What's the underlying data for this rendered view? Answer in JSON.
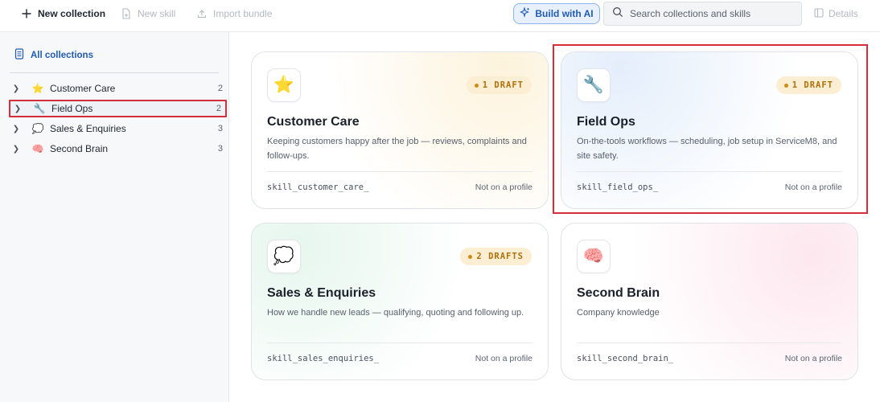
{
  "toolbar": {
    "new_collection": "New collection",
    "new_skill": "New skill",
    "import_bundle": "Import bundle",
    "build_ai": "Build with AI",
    "search_placeholder": "Search collections and skills",
    "details": "Details"
  },
  "sidebar": {
    "all_collections": "All collections",
    "items": [
      {
        "emoji": "⭐",
        "label": "Customer Care",
        "count": "2"
      },
      {
        "emoji": "🔧",
        "label": "Field Ops",
        "count": "2"
      },
      {
        "emoji": "💭",
        "label": "Sales & Enquiries",
        "count": "3"
      },
      {
        "emoji": "🧠",
        "label": "Second Brain",
        "count": "3"
      }
    ]
  },
  "cards": [
    {
      "emoji": "⭐",
      "badge": "1 DRAFT",
      "title": "Customer Care",
      "desc": "Keeping customers happy after the job — reviews, complaints and follow-ups.",
      "id": "skill_customer_care_",
      "status": "Not on a profile"
    },
    {
      "emoji": "🔧",
      "badge": "1 DRAFT",
      "title": "Field Ops",
      "desc": "On-the-tools workflows — scheduling, job setup in ServiceM8, and site safety.",
      "id": "skill_field_ops_",
      "status": "Not on a profile"
    },
    {
      "emoji": "💭",
      "badge": "2 DRAFTS",
      "title": "Sales & Enquiries",
      "desc": "How we handle new leads — qualifying, quoting and following up.",
      "id": "skill_sales_enquiries_",
      "status": "Not on a profile"
    },
    {
      "emoji": "🧠",
      "badge": "",
      "title": "Second Brain",
      "desc": "Company knowledge",
      "id": "skill_second_brain_",
      "status": "Not on a profile"
    }
  ],
  "colors": {
    "accent": "#1f5bb5",
    "highlight": "#d52e3a",
    "badge_bg": "#fbeed2",
    "badge_text": "#b0700a"
  }
}
